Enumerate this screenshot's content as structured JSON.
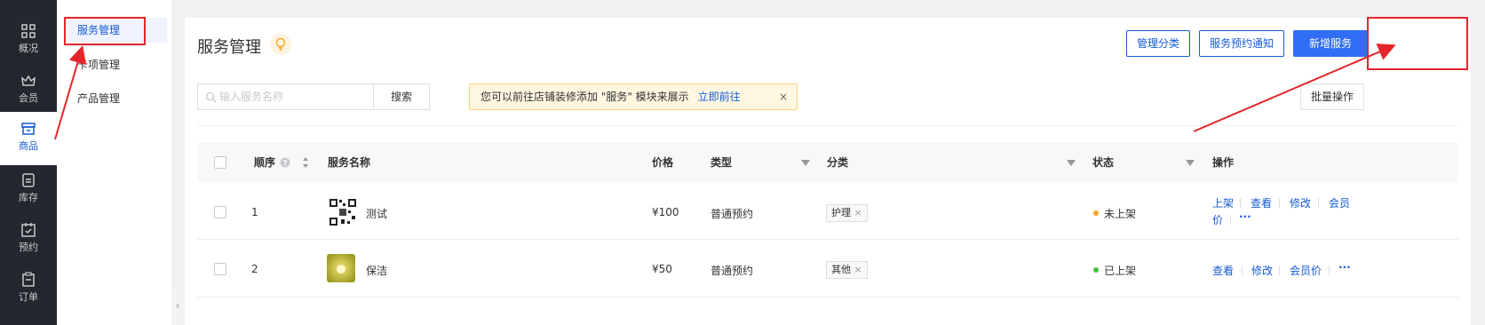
{
  "left_nav": {
    "items": [
      {
        "label": "概况",
        "icon": "grid-icon"
      },
      {
        "label": "会员",
        "icon": "crown-icon"
      },
      {
        "label": "商品",
        "icon": "store-icon",
        "active": true
      },
      {
        "label": "库存",
        "icon": "inventory-icon"
      },
      {
        "label": "预约",
        "icon": "calendar-check-icon"
      },
      {
        "label": "订单",
        "icon": "clipboard-icon"
      }
    ]
  },
  "sub_nav": {
    "items": [
      {
        "label": "服务管理",
        "active": true
      },
      {
        "label": "卡项管理"
      },
      {
        "label": "产品管理"
      }
    ],
    "collapse_glyph": "‹"
  },
  "page": {
    "title": "服务管理",
    "buttons": {
      "manage_category": "管理分类",
      "booking_notice": "服务预约通知",
      "add_service": "新增服务",
      "batch": "批量操作"
    },
    "search": {
      "placeholder": "输入服务名称",
      "value": "",
      "button": "搜索"
    },
    "notice": {
      "text": "您可以前往店铺装修添加 \"服务\" 模块来展示",
      "link": "立即前往",
      "close": "×"
    }
  },
  "table": {
    "headers": {
      "order": "顺序",
      "name": "服务名称",
      "price": "价格",
      "type": "类型",
      "category": "分类",
      "status": "状态",
      "actions": "操作"
    },
    "rows": [
      {
        "order": "1",
        "name": "测试",
        "price": "¥100",
        "type": "普通预约",
        "category": "护理",
        "status": "未上架",
        "status_color": "#f5a623",
        "actions": [
          "上架",
          "查看",
          "修改",
          "会员",
          "价"
        ],
        "more": "···"
      },
      {
        "order": "2",
        "name": "保洁",
        "price": "¥50",
        "type": "普通预约",
        "category": "其他",
        "status": "已上架",
        "status_color": "#44c23a",
        "actions": [
          "查看",
          "修改",
          "会员价"
        ],
        "more": "···"
      }
    ]
  },
  "colors": {
    "accent": "#2f6ef5",
    "link": "#155bd4",
    "annotation": "#e5252a",
    "sidebar": "#24272e"
  }
}
